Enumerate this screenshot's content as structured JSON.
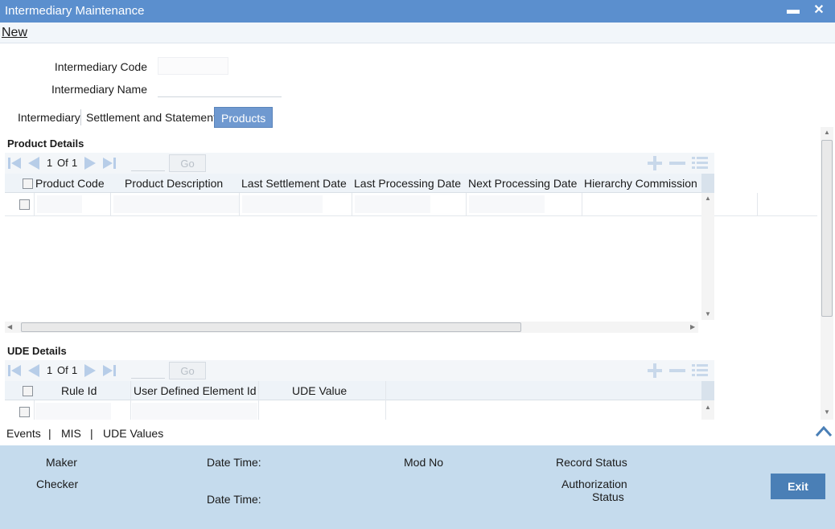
{
  "window": {
    "title": "Intermediary Maintenance",
    "minimize_glyph": "▬",
    "close_glyph": "✕"
  },
  "menu": {
    "new_label": "New"
  },
  "form": {
    "code_label": "Intermediary Code",
    "code_value": "",
    "name_label": "Intermediary Name",
    "name_value": ""
  },
  "tabs": [
    {
      "label": "Intermediary",
      "active": false
    },
    {
      "label": "Settlement and Statement",
      "active": false
    },
    {
      "label": "Products",
      "active": true
    }
  ],
  "product_details": {
    "title": "Product Details",
    "pager": {
      "current": "1",
      "of_label": "Of",
      "total": "1",
      "go_label": "Go"
    },
    "columns": [
      "Product Code",
      "Product Description",
      "Last Settlement Date",
      "Last Processing Date",
      "Next Processing Date",
      "Hierarchy Commission P"
    ]
  },
  "ude_details": {
    "title": "UDE Details",
    "pager": {
      "current": "1",
      "of_label": "Of",
      "total": "1",
      "go_label": "Go"
    },
    "columns": [
      "Rule Id",
      "User Defined Element Id",
      "UDE Value"
    ]
  },
  "footer_links": {
    "events": "Events",
    "mis": "MIS",
    "ude_values": "UDE Values",
    "separator": "|"
  },
  "audit": {
    "maker": "Maker",
    "checker": "Checker",
    "date_time": "Date Time:",
    "mod_no": "Mod No",
    "record_status": "Record Status",
    "authorization_line1": "Authorization",
    "authorization_line2": "Status",
    "exit_label": "Exit"
  },
  "colors": {
    "titlebar": "#5b8fce",
    "active_tab": "#6f99d0",
    "audit_panel": "#c5dbed",
    "exit_button": "#4a7fb6"
  },
  "icons": [
    "first-page-icon",
    "previous-page-icon",
    "next-page-icon",
    "last-page-icon",
    "add-row-icon",
    "delete-row-icon",
    "single-view-icon",
    "collapse-up-icon"
  ]
}
